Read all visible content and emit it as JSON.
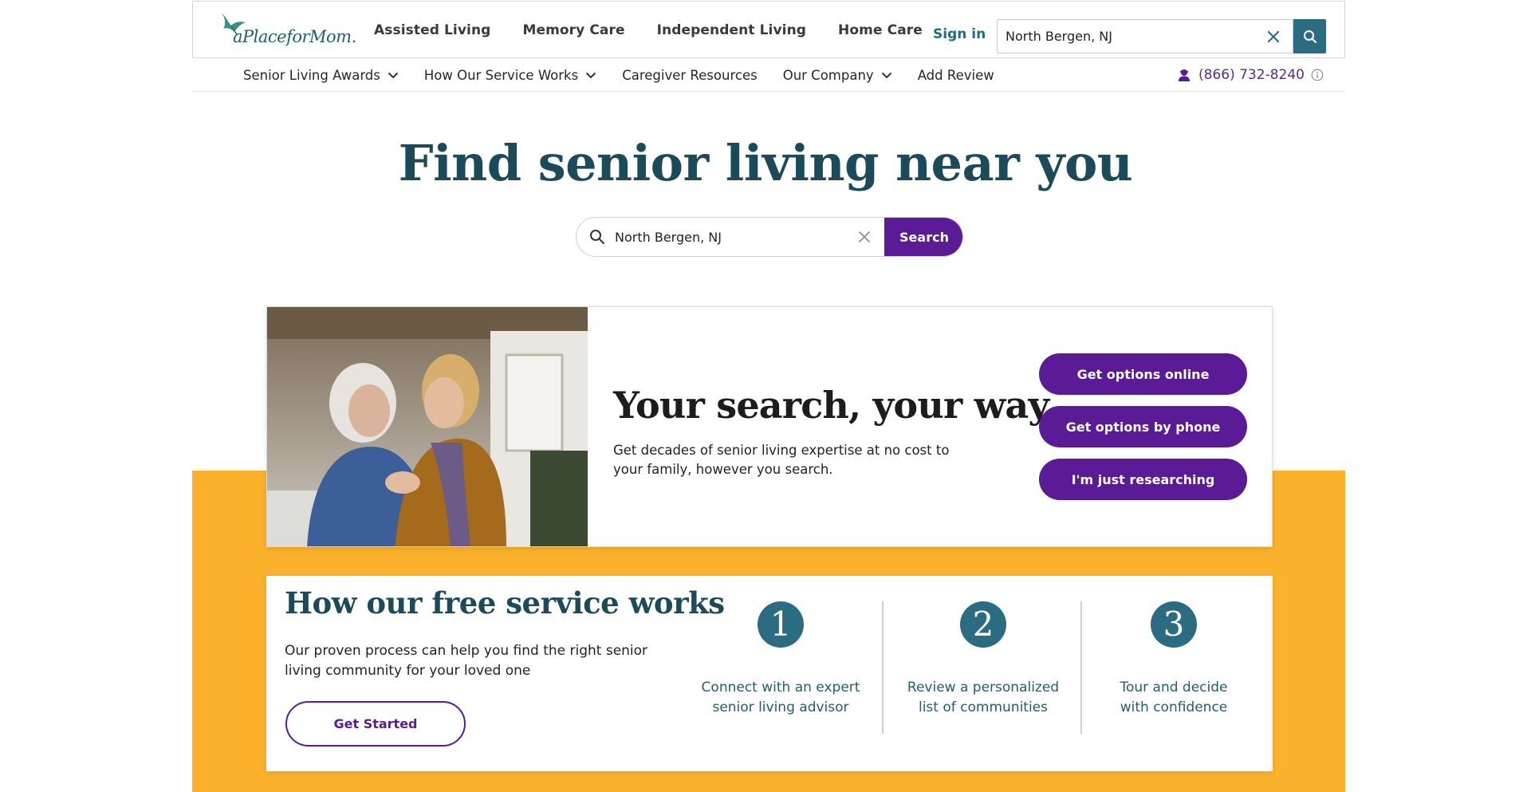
{
  "header": {
    "logo_text": "aPlaceforMom.",
    "nav": [
      "Assisted Living",
      "Memory Care",
      "Independent Living",
      "Home Care"
    ],
    "sign_in": "Sign in",
    "search_value": "North Bergen, NJ"
  },
  "subnav": {
    "items": [
      {
        "label": "Senior Living Awards",
        "dropdown": true
      },
      {
        "label": "How Our Service Works",
        "dropdown": true
      },
      {
        "label": "Caregiver Resources",
        "dropdown": false
      },
      {
        "label": "Our Company",
        "dropdown": true
      },
      {
        "label": "Add Review",
        "dropdown": false
      }
    ],
    "phone": "(866) 732-8240"
  },
  "hero": {
    "title": "Find senior living near you",
    "search_value": "North Bergen, NJ",
    "search_button": "Search"
  },
  "card_search": {
    "title": "Your search, your way",
    "description": "Get decades of senior living expertise at no cost to your family, however you search.",
    "buttons": [
      "Get options online",
      "Get options by phone",
      "I'm just researching"
    ]
  },
  "card_service": {
    "title": "How our free service works",
    "description": "Our proven process can help you find the right senior living community for your loved one",
    "cta": "Get Started",
    "steps": [
      {
        "num": "1",
        "text": "Connect with an expert senior living advisor"
      },
      {
        "num": "2",
        "text": "Review a personalized list of communities"
      },
      {
        "num": "3",
        "text": "Tour and decide with confidence"
      }
    ]
  },
  "colors": {
    "brand_purple": "#5b1a96",
    "brand_teal": "#2b6c82",
    "heading_teal": "#1b4a5a",
    "band_yellow": "#fbb12c"
  }
}
